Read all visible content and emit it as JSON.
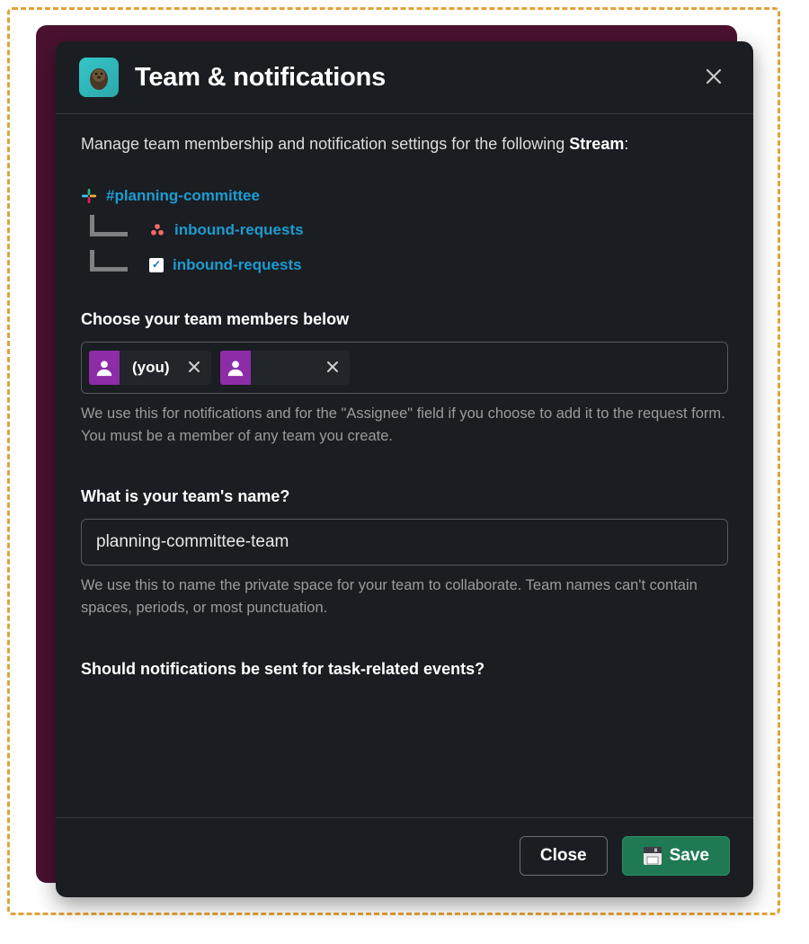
{
  "dialog": {
    "title": "Team & notifications",
    "intro_prefix": "Manage team membership and notification settings for the following ",
    "intro_bold": "Stream",
    "intro_suffix": ":"
  },
  "streams": {
    "root": "#planning-committee",
    "child_a": "inbound-requests",
    "child_b": "inbound-requests"
  },
  "members": {
    "label": "Choose your team members below",
    "chips": [
      {
        "label": "(you)"
      },
      {
        "label": ""
      }
    ],
    "helper": "We use this for notifications and for the \"Assignee\" field if you choose to add it to the request form.  You must be a member of any team you create."
  },
  "team_name": {
    "label": "What is your team's name?",
    "value": "planning-committee-team",
    "helper": "We use this to name the private space for your team to collaborate.  Team names can't contain spaces, periods, or most punctuation."
  },
  "notifications": {
    "label": "Should notifications be sent for task-related events?"
  },
  "footer": {
    "close": "Close",
    "save": "Save"
  }
}
